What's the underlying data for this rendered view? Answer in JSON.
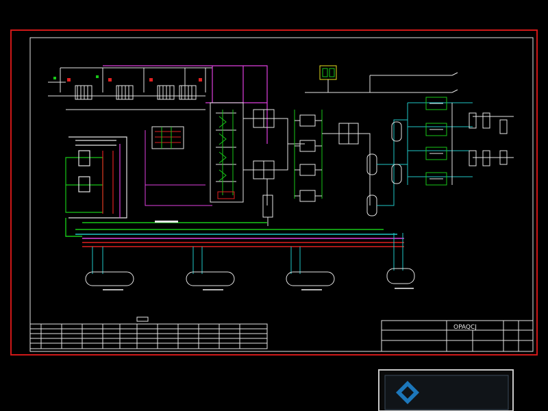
{
  "drawing": {
    "background": "#000000",
    "frame_color": "#d01818",
    "border_color": "#e6e6e6",
    "line_colors": {
      "white": "#e6e6e6",
      "magenta": "#e040e0",
      "green": "#18c818",
      "cyan": "#20c8c8",
      "red": "#e02020",
      "yellow": "#e8e020"
    },
    "drawing_number": "OPAQCJ"
  },
  "title_block": {
    "company": "",
    "project": "",
    "drawing_title": ""
  },
  "legend_table": {
    "title": "",
    "rows": 5,
    "columns": 12
  },
  "watermark": {
    "logo_icon": "diamond-shield-icon",
    "brand_text": "",
    "url_text": ""
  }
}
